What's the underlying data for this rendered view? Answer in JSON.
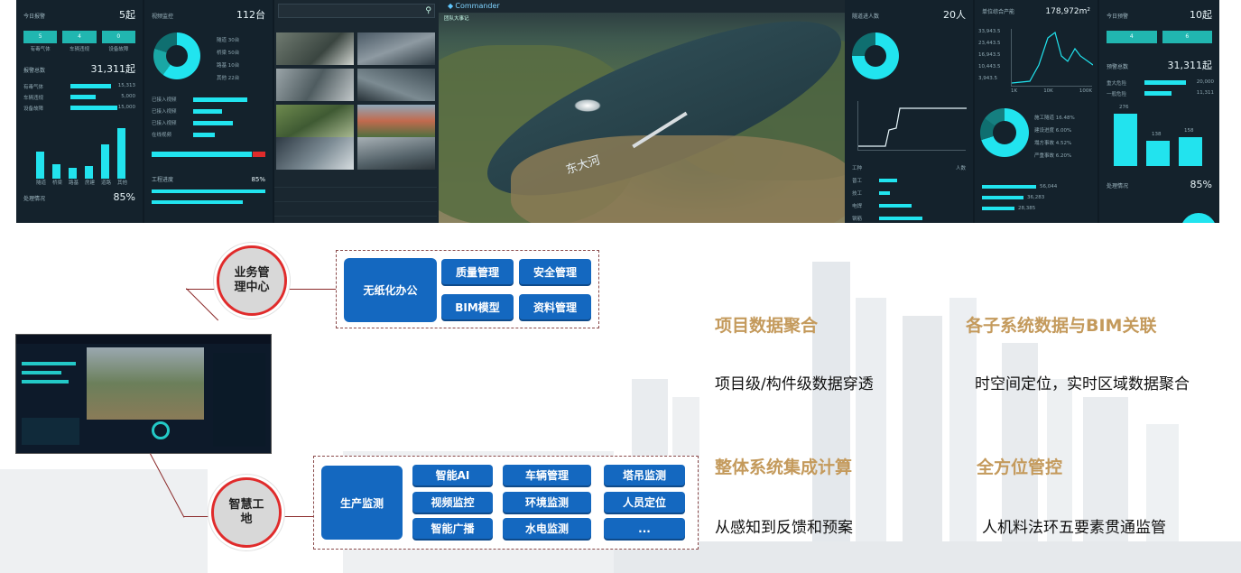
{
  "dashboard": {
    "left_panel": {
      "title": "今日报警",
      "value": "5起",
      "buttons": [
        "5",
        "4",
        "0"
      ],
      "btn_labels": [
        "有毒气体",
        "车辆违规",
        "设备故障"
      ],
      "total_label": "报警总数",
      "total_value": "31,311起",
      "rows": [
        {
          "label": "有毒气体",
          "value": "15,313"
        },
        {
          "label": "车辆违规",
          "value": "5,000"
        },
        {
          "label": "设备故障",
          "value": "15,000"
        }
      ],
      "bar_values": [
        "552",
        "276",
        "200",
        "248",
        "675",
        "1,000"
      ],
      "bar_labels": [
        "隧道",
        "桥梁",
        "路基",
        "房建",
        "道路",
        "其他"
      ],
      "footer_label": "处理情况",
      "footer_value": "85%"
    },
    "cam_panel": {
      "title": "视频监控",
      "value": "112台",
      "legend": [
        "隧道 30台",
        "桥梁 50台",
        "路基 10台",
        "其他 22台"
      ],
      "progress_labels": [
        "已接入视频",
        "已接入视频",
        "已接入视频",
        "在线视频"
      ],
      "footer_label": "工程进度",
      "footer_value": "85%"
    },
    "map": {
      "title": "Commander",
      "subtitle": "团队大事记",
      "river_label": "东大河"
    },
    "right_panel": {
      "title": "隧道进人数",
      "value": "20人",
      "peak_title": "单位综合产能",
      "peak_value": "178,972m²",
      "y_ticks": [
        "33,943.5",
        "23,443.5",
        "16,943.5",
        "10,443.5",
        "3,943.5"
      ],
      "x_ticks": [
        "1K",
        "10K",
        "100K"
      ],
      "legend": [
        "施工隧道 16.48%",
        "建设进度 6.00%",
        "塌方事故 4.52%",
        "严重事故 6.20%"
      ],
      "table_head": [
        "工种",
        "人数"
      ],
      "table_rows": [
        "普工",
        "技工",
        "电焊",
        "钢筋"
      ],
      "stats": [
        "56,044",
        "36,283",
        "28,385"
      ]
    },
    "far_right": {
      "title": "今日预警",
      "value": "10起",
      "buttons": [
        "4",
        "6"
      ],
      "total_label": "预警总数",
      "total_value": "31,311起",
      "rows": [
        {
          "label": "重大危险",
          "value": "20,000"
        },
        {
          "label": "一般危险",
          "value": "11,311"
        }
      ],
      "bar_values": [
        "276",
        "138",
        "158"
      ],
      "footer_label": "处理情况",
      "footer_value": "85%"
    }
  },
  "diagram": {
    "node_top": "业务管理中心",
    "node_bottom": "智慧工地",
    "group_top": {
      "main": "无纸化办公",
      "items": [
        "质量管理",
        "安全管理",
        "BIM模型",
        "资料管理"
      ]
    },
    "group_bottom": {
      "main": "生产监测",
      "items": [
        "智能AI",
        "车辆管理",
        "塔吊监测",
        "视频监控",
        "环境监测",
        "人员定位",
        "智能广播",
        "水电监测",
        "..."
      ]
    }
  },
  "features": [
    {
      "heading": "项目数据聚合",
      "desc": "项目级/构件级数据穿透"
    },
    {
      "heading": "各子系统数据与BIM关联",
      "desc": "时空间定位，实时区域数据聚合"
    },
    {
      "heading": "整体系统集成计算",
      "desc": "从感知到反馈和预案"
    },
    {
      "heading": "全方位管控",
      "desc": "人机料法环五要素贯通监管"
    }
  ],
  "colors": {
    "accent": "#c49a5c",
    "button": "#1468c0",
    "node_border": "#e02b2b",
    "dash_bg": "#0f1b24",
    "cyan": "#21e4ef"
  }
}
